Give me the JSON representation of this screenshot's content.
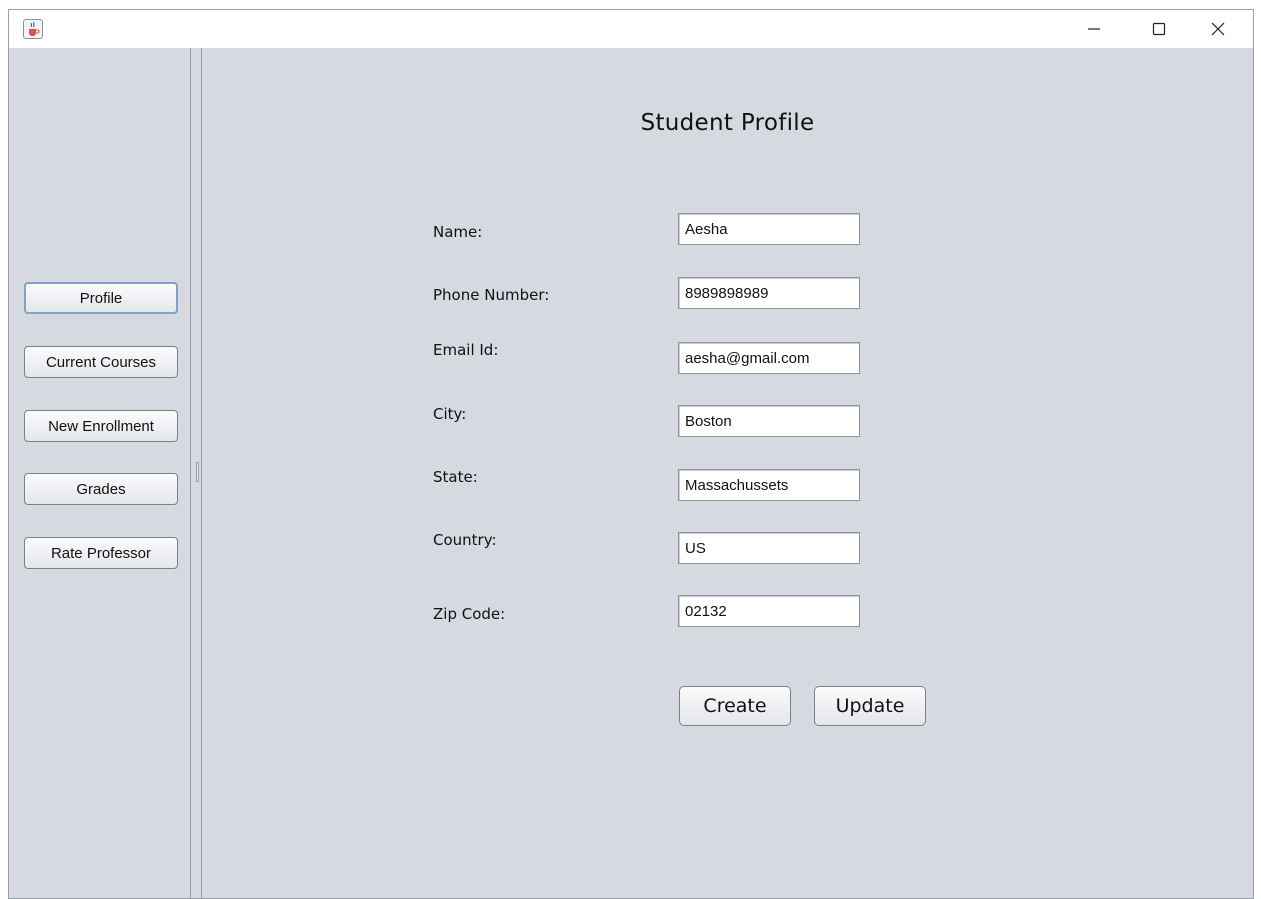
{
  "titlebar": {
    "app_icon": "java-cup-icon",
    "minimize_icon": "minimize-icon",
    "maximize_icon": "maximize-icon",
    "close_icon": "close-icon"
  },
  "sidebar": {
    "items": [
      {
        "label": "Profile",
        "selected": true
      },
      {
        "label": "Current Courses",
        "selected": false
      },
      {
        "label": "New Enrollment",
        "selected": false
      },
      {
        "label": "Grades",
        "selected": false
      },
      {
        "label": "Rate Professor",
        "selected": false
      }
    ]
  },
  "form": {
    "title": "Student Profile",
    "fields": [
      {
        "label": "Name:",
        "value": "Aesha"
      },
      {
        "label": "Phone Number:",
        "value": "8989898989"
      },
      {
        "label": "Email Id:",
        "value": "aesha@gmail.com"
      },
      {
        "label": "City:",
        "value": "Boston"
      },
      {
        "label": "State:",
        "value": "Massachussets"
      },
      {
        "label": "Country:",
        "value": "US"
      },
      {
        "label": "Zip Code:",
        "value": "02132"
      }
    ],
    "create_label": "Create",
    "update_label": "Update"
  },
  "colors": {
    "panel_background": "#d6d9e0",
    "selected_border": "#7da2ce"
  }
}
